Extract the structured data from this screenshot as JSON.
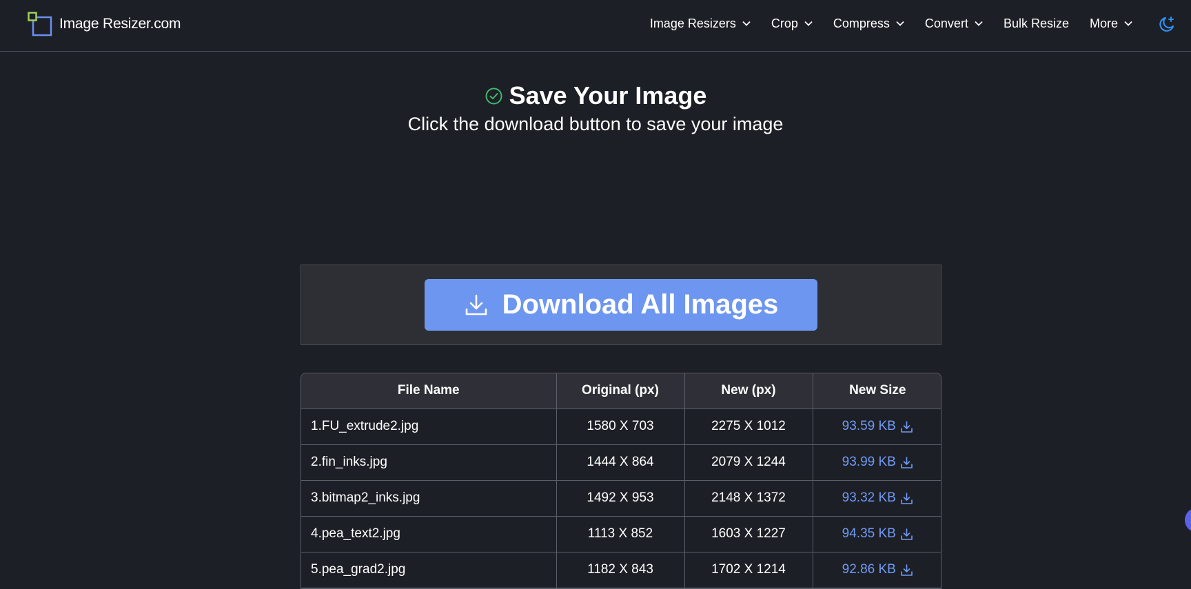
{
  "header": {
    "logo_text": "Image Resizer.com",
    "nav": [
      {
        "label": "Image Resizers",
        "has_dropdown": true
      },
      {
        "label": "Crop",
        "has_dropdown": true
      },
      {
        "label": "Compress",
        "has_dropdown": true
      },
      {
        "label": "Convert",
        "has_dropdown": true
      },
      {
        "label": "Bulk Resize",
        "has_dropdown": false
      },
      {
        "label": "More",
        "has_dropdown": true
      }
    ],
    "theme_icon": "moon-star-icon"
  },
  "hero": {
    "title": "Save Your Image",
    "subtitle": "Click the download button to save your image",
    "title_icon": "check-circle-icon"
  },
  "download": {
    "button_label": "Download All Images",
    "icon": "download-icon"
  },
  "table": {
    "headers": [
      "File Name",
      "Original (px)",
      "New (px)",
      "New Size"
    ],
    "rows": [
      {
        "file": "1.FU_extrude2.jpg",
        "original": "1580 X 703",
        "new": "2275 X 1012",
        "size": "93.59 KB"
      },
      {
        "file": "2.fin_inks.jpg",
        "original": "1444 X 864",
        "new": "2079 X 1244",
        "size": "93.99 KB"
      },
      {
        "file": "3.bitmap2_inks.jpg",
        "original": "1492 X 953",
        "new": "2148 X 1372",
        "size": "93.32 KB"
      },
      {
        "file": "4.pea_text2.jpg",
        "original": "1113 X 852",
        "new": "1603 X 1227",
        "size": "94.35 KB"
      },
      {
        "file": "5.pea_grad2.jpg",
        "original": "1182 X 843",
        "new": "1702 X 1214",
        "size": "92.86 KB"
      }
    ]
  },
  "colors": {
    "background": "#1d1f26",
    "accent": "#6d96f0",
    "link": "#6f9bf5",
    "success": "#3fb96b"
  }
}
